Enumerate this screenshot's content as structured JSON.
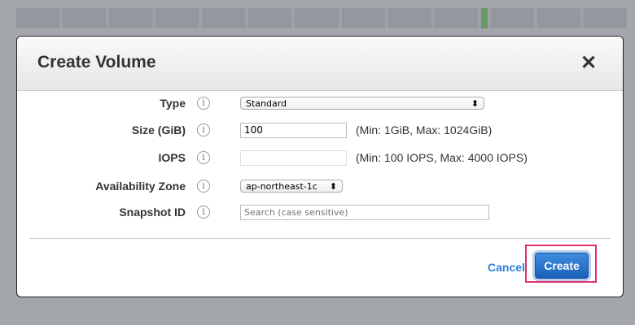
{
  "dialog": {
    "title": "Create Volume",
    "close": "✕"
  },
  "fields": [
    {
      "label": "Type",
      "value": "Standard"
    },
    {
      "label": "Size (GiB)",
      "value": "100",
      "hint": "(Min: 1GiB, Max: 1024GiB)"
    },
    {
      "label": "IOPS",
      "value": "",
      "hint": "(Min: 100 IOPS, Max: 4000 IOPS)"
    },
    {
      "label": "Availability Zone",
      "value": "ap-northeast-1c"
    },
    {
      "label": "Snapshot ID",
      "placeholder": "Search (case sensitive)"
    }
  ],
  "info_glyph": "i",
  "select_arrow": "⬍",
  "actions": {
    "cancel": "Cancel",
    "create": "Create"
  }
}
